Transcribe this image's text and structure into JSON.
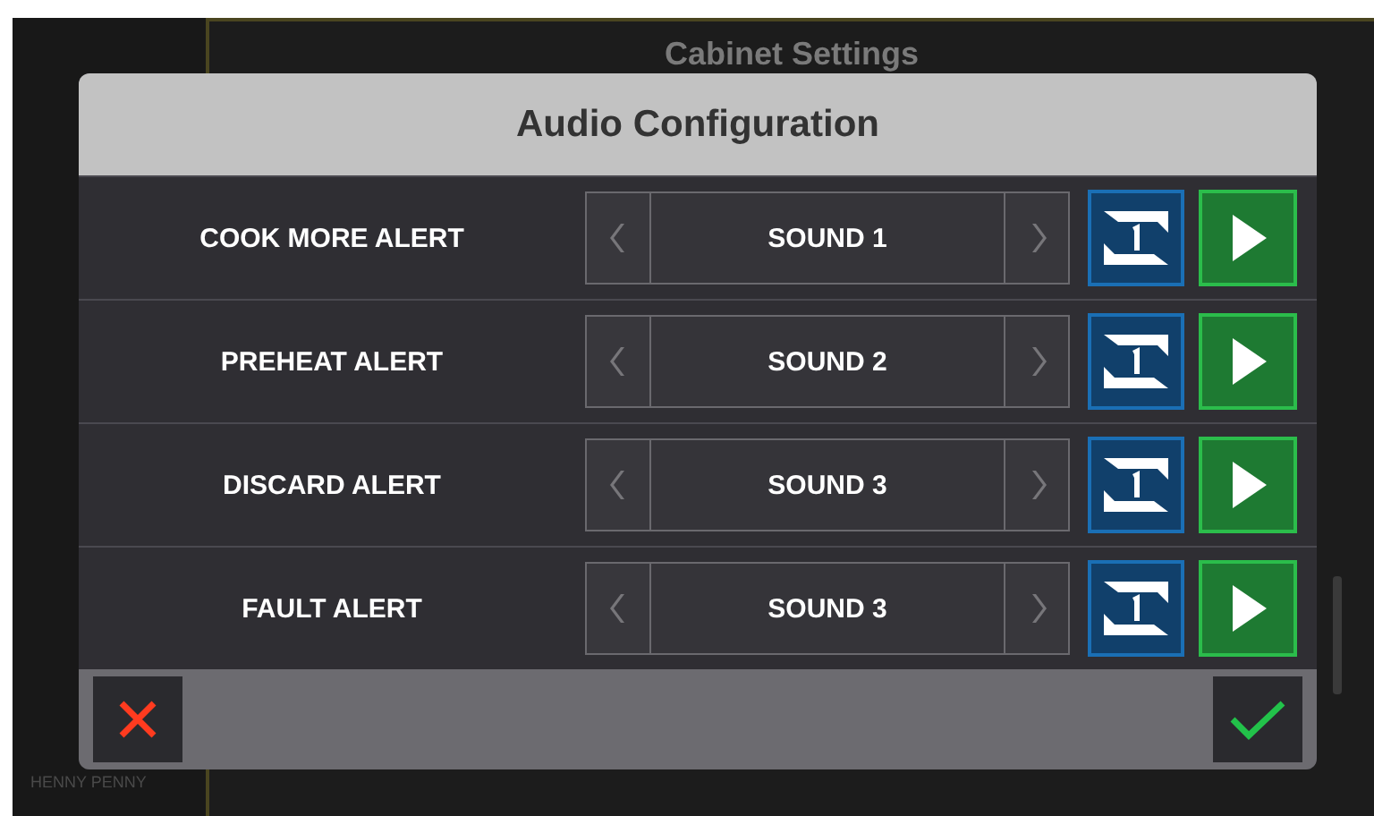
{
  "background": {
    "title": "Cabinet Settings",
    "brand": "HENNY PENNY"
  },
  "dialog": {
    "title": "Audio Configuration",
    "rows": [
      {
        "label": "COOK MORE ALERT",
        "sound": "SOUND 1"
      },
      {
        "label": "PREHEAT ALERT",
        "sound": "SOUND 2"
      },
      {
        "label": "DISCARD ALERT",
        "sound": "SOUND 3"
      },
      {
        "label": "FAULT ALERT",
        "sound": "SOUND 3"
      }
    ]
  }
}
